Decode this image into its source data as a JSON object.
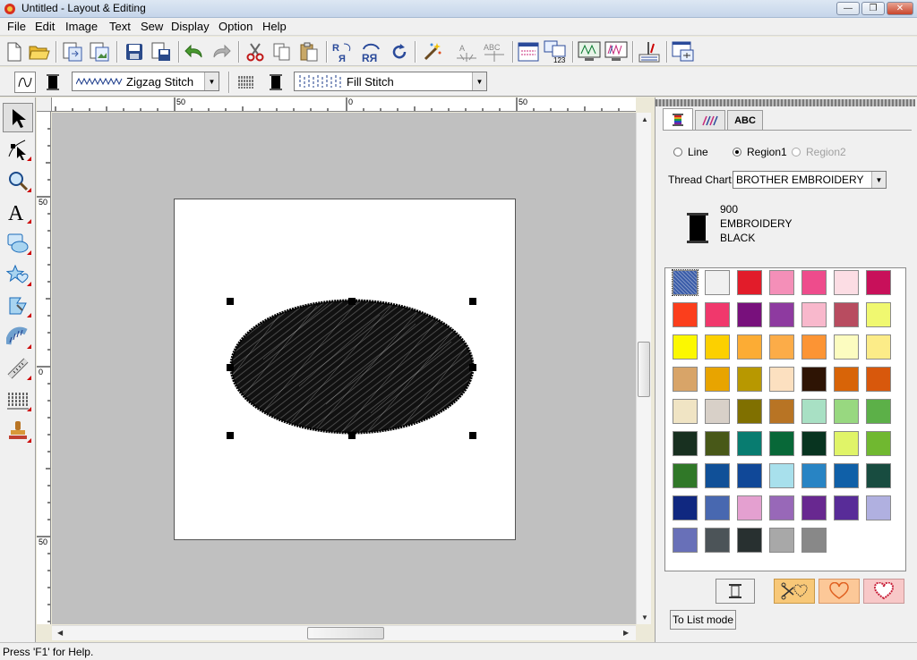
{
  "window": {
    "title": "Untitled - Layout & Editing"
  },
  "menu": [
    "File",
    "Edit",
    "Image",
    "Text",
    "Sew",
    "Display",
    "Option",
    "Help"
  ],
  "toolbar2": {
    "line_stitch": "Zigzag Stitch",
    "region_stitch": "Fill Stitch"
  },
  "rulers": {
    "h_labels": [
      "50",
      "0",
      "50"
    ],
    "v_labels": [
      "50",
      "0",
      "50"
    ]
  },
  "right_panel": {
    "tabs": [
      "thread-color-tab",
      "sewing-attribute-tab",
      "ABC"
    ],
    "radio": {
      "line": "Line",
      "region1": "Region1",
      "region2": "Region2",
      "selected": "region1"
    },
    "thread_chart_label": "Thread Chart:",
    "thread_chart_value": "BROTHER EMBROIDERY",
    "thread": {
      "number": "900",
      "name_line1": "EMBROIDERY",
      "name_line2": "BLACK",
      "color": "#000000"
    },
    "swatches": [
      "#3a5ca8",
      "#f0f0f0",
      "#e21c2a",
      "#f48fb8",
      "#ee4c8c",
      "#fcdde4",
      "#c8105a",
      "#fb3e1c",
      "#f0386c",
      "#78107c",
      "#8e3aa0",
      "#f8b8cc",
      "#b84c60",
      "#f0f870",
      "#fcf800",
      "#fcd000",
      "#fcac34",
      "#fcac48",
      "#fc9434",
      "#fcfcc0",
      "#fcec88",
      "#d8a468",
      "#e8a400",
      "#b89800",
      "#fce0c0",
      "#2e1404",
      "#d86408",
      "#d8580c",
      "#f0e4c4",
      "#d8d0c8",
      "#807000",
      "#b87424",
      "#a8e0c4",
      "#98d880",
      "#5cb048",
      "#183020",
      "#485818",
      "#087c70",
      "#086838",
      "#083420",
      "#e0f468",
      "#70b830",
      "#307828",
      "#105098",
      "#104898",
      "#a8e0ec",
      "#2884c4",
      "#1060a8",
      "#184c40",
      "#102880",
      "#4868b0",
      "#e4a0d0",
      "#9868b8",
      "#682890",
      "#582c98",
      "#b0b0e0",
      "#6870b8",
      "#4c5458",
      "#283030",
      "#a8a8a8",
      "#888888"
    ],
    "to_list_label": "To List mode"
  },
  "status": {
    "text": "Press 'F1' for Help."
  }
}
